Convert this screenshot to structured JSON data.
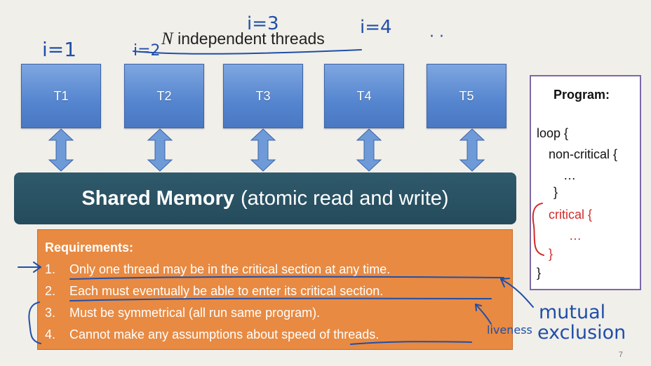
{
  "title": {
    "var": "N",
    "text": "independent threads"
  },
  "threads": [
    "T1",
    "T2",
    "T3",
    "T4",
    "T5"
  ],
  "memory": {
    "bold": "Shared Memory",
    "rest": "(atomic read and write)"
  },
  "requirements": {
    "title": "Requirements:",
    "items": [
      {
        "num": "1.",
        "text": "Only one thread may be in the critical section at any time."
      },
      {
        "num": "2.",
        "text": "Each must eventually be able to enter its critical section."
      },
      {
        "num": "3.",
        "text": "Must be symmetrical (all run same program)."
      },
      {
        "num": "4.",
        "text": "Cannot make any assumptions about speed of threads."
      }
    ]
  },
  "program": {
    "title": "Program:",
    "lines": [
      "loop {",
      "non-critical {",
      "…",
      "}",
      "critical {",
      "…",
      "}",
      "}"
    ]
  },
  "annotations": {
    "i1": "i=1",
    "i2": "i=2",
    "i3": "i=3",
    "i4": "i=4",
    "dots": "· ·",
    "mutual": "mutual",
    "exclusion": "exclusion",
    "liveness": "liveness"
  },
  "slide_number": "7",
  "colors": {
    "thread_blue": "#5585cf",
    "memory_teal": "#2f5a6c",
    "requirements_orange": "#e88a42",
    "program_border": "#7d67a8",
    "critical_red": "#d22a2a",
    "ink_blue": "#1f4fa8"
  }
}
